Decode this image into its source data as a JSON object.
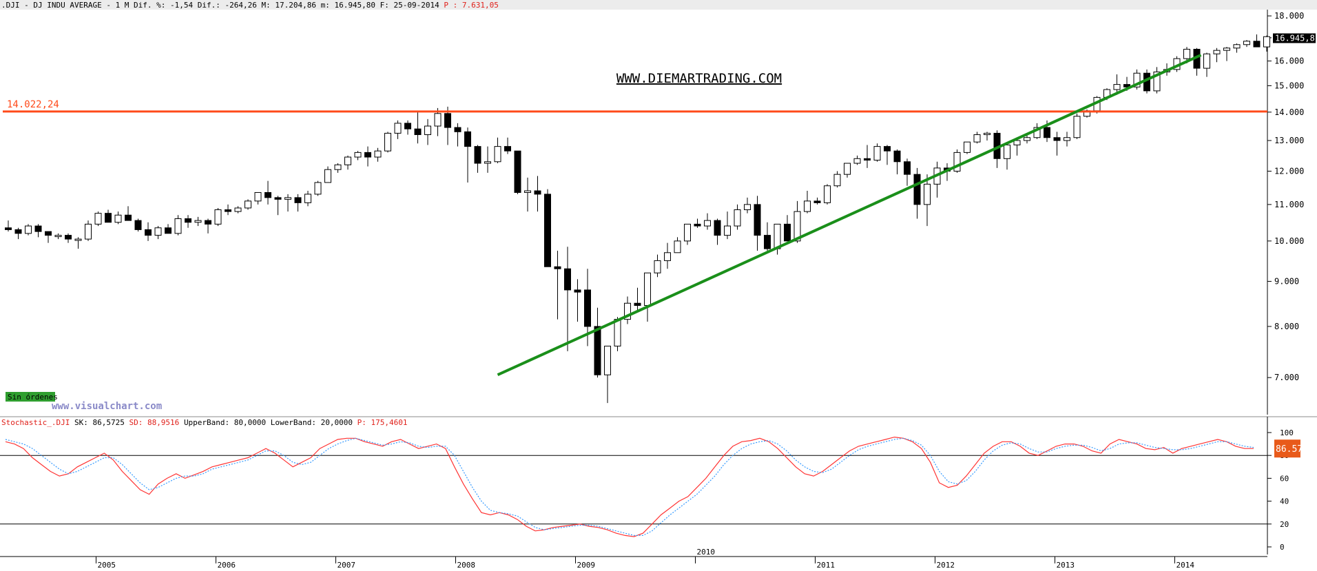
{
  "header": {
    "prefix": ".DJI - DJ INDU AVERAGE -  1 M Dif. %: -1,54 Dif.: -264,26 M: 17.204,86 m: 16.945,80 F: 25-09-2014",
    "p_label": "P : 7.631,05"
  },
  "watermark": "WWW.DIEMARTRADING.COM",
  "visualchart": "www.visualchart.com",
  "status_badge": "Sin órdenes",
  "resistance": {
    "label": "14.022,24",
    "value": 14022.24,
    "color": "#ff4a1a"
  },
  "trendline": {
    "color": "#1a8f1a",
    "start": {
      "index": 49,
      "value": 7050
    },
    "end": {
      "index": 117,
      "value": 16250
    }
  },
  "last_price_label": "16.945,8",
  "stoch_header": {
    "name": "Stochastic_.DJI",
    "sk": "SK: 86,5725",
    "sd": "SD: 88,9516",
    "upper": "UpperBand: 80,0000",
    "lower": "LowerBand: 20,0000",
    "p": "P: 175,4601"
  },
  "stoch_last_label": "86.57",
  "colors": {
    "sk": "#ff3333",
    "sd": "#3399ff",
    "up": "#ffffff",
    "down": "#000000"
  },
  "chart_data": [
    {
      "type": "candlestick",
      "title": "DJ INDU AVERAGE",
      "period": "monthly",
      "ylim": [
        6400,
        18100
      ],
      "log_scale": true,
      "y_ticks": [
        7000,
        8000,
        9000,
        10000,
        11000,
        12000,
        13000,
        14000,
        15000,
        16000,
        17000,
        18000
      ],
      "y_tick_labels": [
        "7.000",
        "8.000",
        "9.000",
        "10.000",
        "11.000",
        "12.000",
        "13.000",
        "14.000",
        "15.000",
        "16.000",
        "17.000",
        "18.000"
      ],
      "x_year_labels": [
        {
          "label": "2005",
          "index": 9
        },
        {
          "label": "2006",
          "index": 21
        },
        {
          "label": "2007",
          "index": 33
        },
        {
          "label": "2008",
          "index": 45
        },
        {
          "label": "2009",
          "index": 57
        },
        {
          "label": "2010",
          "index": 69
        },
        {
          "label": "2011",
          "index": 81
        },
        {
          "label": "2012",
          "index": 93
        },
        {
          "label": "2013",
          "index": 105
        },
        {
          "label": "2014",
          "index": 117
        }
      ],
      "ohlc": [
        [
          10350,
          10550,
          10250,
          10300
        ],
        [
          10300,
          10350,
          10050,
          10200
        ],
        [
          10200,
          10450,
          10150,
          10400
        ],
        [
          10400,
          10450,
          10100,
          10250
        ],
        [
          10250,
          10250,
          9950,
          10150
        ],
        [
          10150,
          10200,
          10050,
          10150
        ],
        [
          10150,
          10200,
          9950,
          10050
        ],
        [
          10050,
          10100,
          9800,
          10050
        ],
        [
          10050,
          10550,
          10000,
          10450
        ],
        [
          10450,
          10800,
          10400,
          10750
        ],
        [
          10750,
          10850,
          10500,
          10500
        ],
        [
          10500,
          10800,
          10450,
          10700
        ],
        [
          10700,
          10950,
          10550,
          10550
        ],
        [
          10550,
          10600,
          10250,
          10300
        ],
        [
          10300,
          10500,
          10000,
          10150
        ],
        [
          10150,
          10400,
          10050,
          10350
        ],
        [
          10350,
          10450,
          10250,
          10200
        ],
        [
          10200,
          10700,
          10150,
          10600
        ],
        [
          10600,
          10700,
          10350,
          10500
        ],
        [
          10500,
          10650,
          10400,
          10550
        ],
        [
          10550,
          10600,
          10200,
          10450
        ],
        [
          10450,
          10900,
          10400,
          10850
        ],
        [
          10850,
          11000,
          10700,
          10800
        ],
        [
          10800,
          10950,
          10750,
          10900
        ],
        [
          10900,
          11150,
          10850,
          11100
        ],
        [
          11100,
          11250,
          11000,
          11350
        ],
        [
          11350,
          11700,
          11000,
          11200
        ],
        [
          11200,
          11250,
          10700,
          11150
        ],
        [
          11150,
          11300,
          10800,
          11200
        ],
        [
          11200,
          11300,
          10800,
          11050
        ],
        [
          11050,
          11400,
          10950,
          11300
        ],
        [
          11300,
          11700,
          11250,
          11650
        ],
        [
          11650,
          12150,
          11650,
          12050
        ],
        [
          12050,
          12250,
          11950,
          12200
        ],
        [
          12200,
          12500,
          12050,
          12450
        ],
        [
          12450,
          12650,
          12350,
          12600
        ],
        [
          12600,
          12800,
          12150,
          12450
        ],
        [
          12450,
          12750,
          12300,
          12650
        ],
        [
          12650,
          13300,
          12600,
          13250
        ],
        [
          13250,
          13700,
          13050,
          13600
        ],
        [
          13600,
          13700,
          13200,
          13400
        ],
        [
          13400,
          14000,
          12900,
          13200
        ],
        [
          13200,
          13750,
          12850,
          13500
        ],
        [
          13500,
          14150,
          13150,
          13950
        ],
        [
          13950,
          14200,
          12850,
          13450
        ],
        [
          13450,
          13600,
          12800,
          13300
        ],
        [
          13300,
          13450,
          11650,
          12800
        ],
        [
          12800,
          12850,
          11950,
          12250
        ],
        [
          12250,
          12800,
          11950,
          12300
        ],
        [
          12300,
          13100,
          12250,
          12800
        ],
        [
          12800,
          13100,
          12550,
          12650
        ],
        [
          12650,
          12650,
          11300,
          11350
        ],
        [
          11350,
          11800,
          10800,
          11400
        ],
        [
          11400,
          11850,
          10800,
          11300
        ],
        [
          11300,
          11450,
          9900,
          9350
        ],
        [
          9350,
          9750,
          8150,
          9300
        ],
        [
          9300,
          9850,
          7500,
          8800
        ],
        [
          8800,
          9050,
          8100,
          8750
        ],
        [
          8800,
          9300,
          7600,
          8000
        ],
        [
          8000,
          8400,
          7000,
          7050
        ],
        [
          7050,
          7600,
          6550,
          7600
        ],
        [
          7600,
          8200,
          7500,
          8150
        ],
        [
          8150,
          8650,
          8050,
          8500
        ],
        [
          8500,
          8850,
          8300,
          8450
        ],
        [
          8450,
          9200,
          8100,
          9200
        ],
        [
          9200,
          9650,
          9100,
          9500
        ],
        [
          9500,
          9950,
          9300,
          9700
        ],
        [
          9700,
          10100,
          9700,
          10000
        ],
        [
          10000,
          10400,
          9900,
          10450
        ],
        [
          10450,
          10600,
          10350,
          10400
        ],
        [
          10400,
          10750,
          10300,
          10550
        ],
        [
          10550,
          10600,
          9900,
          10150
        ],
        [
          10150,
          10800,
          10050,
          10400
        ],
        [
          10400,
          11000,
          10300,
          10850
        ],
        [
          10850,
          11200,
          10750,
          11000
        ],
        [
          11000,
          11250,
          9750,
          10150
        ],
        [
          10150,
          10500,
          9750,
          9800
        ],
        [
          9800,
          10400,
          9650,
          10450
        ],
        [
          10450,
          10700,
          10350,
          10000
        ],
        [
          10000,
          11100,
          9950,
          10800
        ],
        [
          10800,
          11400,
          10750,
          11100
        ],
        [
          11100,
          11200,
          11000,
          11050
        ],
        [
          11050,
          11600,
          11000,
          11550
        ],
        [
          11550,
          12000,
          11500,
          11900
        ],
        [
          11900,
          12200,
          11800,
          12250
        ],
        [
          12250,
          12500,
          12200,
          12400
        ],
        [
          12400,
          12850,
          12100,
          12350
        ],
        [
          12350,
          12900,
          12300,
          12800
        ],
        [
          12800,
          12850,
          12200,
          12650
        ],
        [
          12650,
          12700,
          11900,
          12300
        ],
        [
          12300,
          12400,
          11550,
          11900
        ],
        [
          11900,
          12100,
          10600,
          11000
        ],
        [
          11000,
          11900,
          10400,
          11600
        ],
        [
          11600,
          12300,
          11200,
          12100
        ],
        [
          12100,
          12250,
          11700,
          12000
        ],
        [
          12000,
          12700,
          11950,
          12600
        ],
        [
          12600,
          12950,
          12550,
          12950
        ],
        [
          12950,
          13300,
          12900,
          13200
        ],
        [
          13200,
          13300,
          13000,
          13250
        ],
        [
          13250,
          13350,
          12100,
          12400
        ],
        [
          12400,
          12850,
          12050,
          12850
        ],
        [
          12850,
          13100,
          12500,
          13000
        ],
        [
          13000,
          13200,
          12900,
          13100
        ],
        [
          13100,
          13600,
          13050,
          13450
        ],
        [
          13450,
          13700,
          12950,
          13100
        ],
        [
          13100,
          13300,
          12500,
          13000
        ],
        [
          13000,
          13300,
          12800,
          13100
        ],
        [
          13100,
          13950,
          13050,
          13850
        ],
        [
          13850,
          14100,
          13800,
          14050
        ],
        [
          14050,
          14600,
          13950,
          14550
        ],
        [
          14550,
          14900,
          14450,
          14850
        ],
        [
          14850,
          15450,
          14650,
          15050
        ],
        [
          15050,
          15350,
          14800,
          14950
        ],
        [
          14950,
          15650,
          14850,
          15500
        ],
        [
          15500,
          15650,
          14700,
          14800
        ],
        [
          14800,
          15750,
          14700,
          15550
        ],
        [
          15550,
          15900,
          15400,
          15650
        ],
        [
          15650,
          16200,
          15550,
          16100
        ],
        [
          16100,
          16600,
          15900,
          16500
        ],
        [
          16500,
          16550,
          15400,
          15700
        ],
        [
          15700,
          16350,
          15350,
          16300
        ],
        [
          16300,
          16550,
          15950,
          16450
        ],
        [
          16450,
          16600,
          16000,
          16550
        ],
        [
          16550,
          16750,
          16350,
          16700
        ],
        [
          16700,
          16900,
          16600,
          16850
        ],
        [
          16850,
          17150,
          16750,
          16600
        ],
        [
          16600,
          17100,
          16400,
          17050
        ],
        [
          17050,
          17200,
          16900,
          16950
        ]
      ]
    },
    {
      "type": "line",
      "title": "Stochastic_.DJI",
      "ylim": [
        0,
        100
      ],
      "y_ticks": [
        0,
        20,
        40,
        60,
        80,
        100
      ],
      "bands": [
        80,
        20
      ],
      "series": [
        {
          "name": "SK",
          "values": [
            92,
            90,
            86,
            78,
            72,
            66,
            62,
            64,
            70,
            74,
            78,
            82,
            76,
            66,
            58,
            50,
            46,
            55,
            60,
            64,
            60,
            63,
            66,
            70,
            72,
            74,
            76,
            78,
            82,
            86,
            82,
            76,
            70,
            74,
            78,
            86,
            90,
            94,
            95,
            95,
            92,
            90,
            88,
            92,
            94,
            90,
            86,
            88,
            90,
            86,
            70,
            55,
            42,
            30,
            28,
            30,
            28,
            24,
            18,
            14,
            15,
            17,
            18,
            19,
            20,
            18,
            17,
            15,
            12,
            10,
            9,
            12,
            20,
            28,
            34,
            40,
            44,
            52,
            60,
            70,
            80,
            88,
            92,
            93,
            95,
            92,
            86,
            78,
            70,
            64,
            62,
            66,
            72,
            78,
            84,
            88,
            90,
            92,
            94,
            96,
            95,
            92,
            86,
            74,
            56,
            52,
            54,
            62,
            72,
            82,
            88,
            92,
            92,
            88,
            82,
            80,
            84,
            88,
            90,
            90,
            88,
            84,
            82,
            90,
            94,
            92,
            90,
            86,
            85,
            87,
            82,
            86,
            88,
            90,
            92,
            94,
            92,
            88,
            86,
            86
          ]
        },
        {
          "name": "SD",
          "values": [
            94,
            92,
            90,
            86,
            80,
            74,
            68,
            64,
            66,
            70,
            74,
            78,
            78,
            72,
            64,
            56,
            50,
            52,
            56,
            60,
            62,
            62,
            64,
            68,
            70,
            72,
            74,
            76,
            80,
            84,
            84,
            80,
            74,
            72,
            74,
            80,
            86,
            90,
            93,
            95,
            93,
            91,
            89,
            90,
            92,
            91,
            88,
            87,
            88,
            88,
            80,
            66,
            52,
            40,
            32,
            30,
            29,
            27,
            22,
            17,
            15,
            16,
            17,
            18,
            19,
            19,
            18,
            16,
            14,
            12,
            10,
            10,
            14,
            21,
            28,
            34,
            40,
            46,
            54,
            62,
            72,
            80,
            86,
            90,
            92,
            93,
            90,
            84,
            76,
            70,
            66,
            65,
            68,
            74,
            80,
            85,
            88,
            90,
            92,
            94,
            95,
            93,
            89,
            80,
            66,
            57,
            55,
            58,
            66,
            76,
            84,
            89,
            91,
            90,
            86,
            83,
            83,
            86,
            88,
            89,
            89,
            87,
            84,
            86,
            90,
            91,
            91,
            89,
            87,
            86,
            85,
            85,
            86,
            88,
            90,
            92,
            92,
            90,
            88,
            87
          ]
        }
      ]
    }
  ]
}
